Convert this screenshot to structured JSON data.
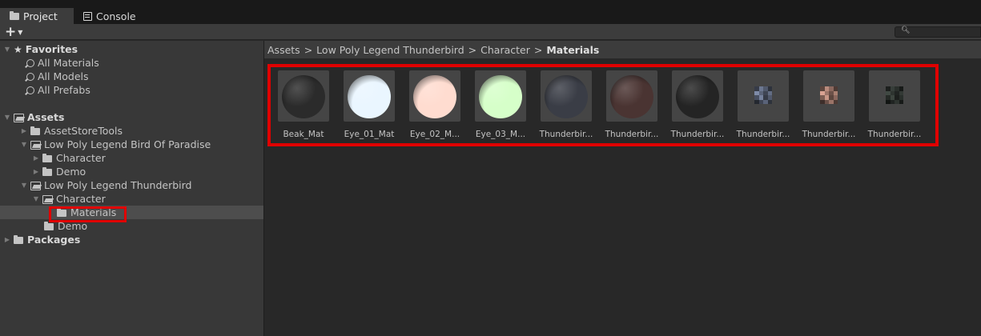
{
  "tabs": [
    {
      "label": "Project",
      "icon": "folder-icon",
      "active": true
    },
    {
      "label": "Console",
      "icon": "console-icon",
      "active": false
    }
  ],
  "toolbar": {
    "add_label": "+",
    "search_placeholder": ""
  },
  "tree": {
    "favorites_label": "Favorites",
    "favorites": [
      "All Materials",
      "All Models",
      "All Prefabs"
    ],
    "assets_label": "Assets",
    "asset_store_tools": "AssetStoreTools",
    "bird_of_paradise": "Low Poly Legend Bird Of Paradise",
    "bop_character": "Character",
    "bop_demo": "Demo",
    "thunderbird": "Low Poly Legend Thunderbird",
    "tb_character": "Character",
    "tb_materials": "Materials",
    "tb_demo": "Demo",
    "packages_label": "Packages"
  },
  "breadcrumb": {
    "items": [
      "Assets",
      "Low Poly Legend Thunderbird",
      "Character"
    ],
    "separator": ">",
    "current": "Materials"
  },
  "assets": [
    {
      "label": "Beak_Mat",
      "kind": "sphere",
      "color": "#2b2b2b"
    },
    {
      "label": "Eye_01_Mat",
      "kind": "sphere",
      "color": "#eaf6ff"
    },
    {
      "label": "Eye_02_M...",
      "kind": "sphere",
      "color": "#ffdcd0"
    },
    {
      "label": "Eye_03_M...",
      "kind": "sphere",
      "color": "#d6ffc9"
    },
    {
      "label": "Thunderbir...",
      "kind": "sphere",
      "color": "#3a3d46"
    },
    {
      "label": "Thunderbir...",
      "kind": "sphere",
      "color": "#4a3432"
    },
    {
      "label": "Thunderbir...",
      "kind": "sphere",
      "color": "#242424"
    },
    {
      "label": "Thunderbir...",
      "kind": "texture",
      "color": "#5a6378"
    },
    {
      "label": "Thunderbir...",
      "kind": "texture",
      "color": "#9a7468"
    },
    {
      "label": "Thunderbir...",
      "kind": "texture",
      "color": "#2e3430"
    }
  ],
  "colors": {
    "highlight": "#e00000",
    "selected_row": "#4d4d4d",
    "panel": "#383838"
  }
}
